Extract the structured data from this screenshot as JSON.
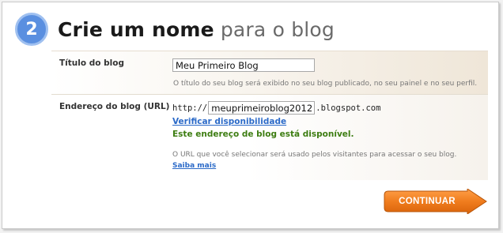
{
  "header": {
    "step_number": "2",
    "title_bold": "Crie um nome",
    "title_light": "para o blog"
  },
  "blog_title": {
    "label": "Título do blog",
    "value": "Meu Primeiro Blog",
    "hint": "O título do seu blog será exibido no seu blog publicado, no seu painel e no seu perfil."
  },
  "blog_address": {
    "label": "Endereço do blog (URL)",
    "prefix": "http://",
    "value": "meuprimeiroblog2012",
    "suffix": ".blogspot.com",
    "check_link": "Verificar disponibilidade",
    "status": "Este endereço de blog está disponível.",
    "hint": "O URL que você selecionar será usado pelos visitantes para acessar o seu blog.",
    "more_link": "Saiba mais"
  },
  "actions": {
    "continue_label": "CONTINUAR"
  },
  "colors": {
    "step_circle": "#5a8fe0",
    "link": "#2b6ac8",
    "available": "#3d7d12",
    "continue_button": "#f07d1e"
  }
}
